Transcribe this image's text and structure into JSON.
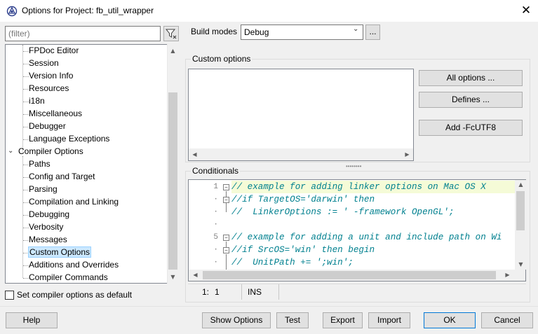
{
  "window": {
    "title": "Options for Project: fb_util_wrapper",
    "close_glyph": "✕",
    "icon": "lazarus-app-icon"
  },
  "filter": {
    "placeholder": "(filter)",
    "button_icon": "filter-funnel-icon"
  },
  "tree": {
    "items": [
      {
        "label": "FPDoc Editor",
        "level": 1
      },
      {
        "label": "Session",
        "level": 1
      },
      {
        "label": "Version Info",
        "level": 1
      },
      {
        "label": "Resources",
        "level": 1
      },
      {
        "label": "i18n",
        "level": 1
      },
      {
        "label": "Miscellaneous",
        "level": 1
      },
      {
        "label": "Debugger",
        "level": 1
      },
      {
        "label": "Language Exceptions",
        "level": 1
      },
      {
        "label": "Compiler Options",
        "level": 0,
        "expanded": true
      },
      {
        "label": "Paths",
        "level": 1
      },
      {
        "label": "Config and Target",
        "level": 1
      },
      {
        "label": "Parsing",
        "level": 1
      },
      {
        "label": "Compilation and Linking",
        "level": 1
      },
      {
        "label": "Debugging",
        "level": 1
      },
      {
        "label": "Verbosity",
        "level": 1
      },
      {
        "label": "Messages",
        "level": 1
      },
      {
        "label": "Custom Options",
        "level": 1,
        "selected": true
      },
      {
        "label": "Additions and Overrides",
        "level": 1
      },
      {
        "label": "Compiler Commands",
        "level": 1
      }
    ],
    "selection_color": "#cce8ff"
  },
  "default_checkbox": {
    "label": "Set compiler options as default",
    "checked": false
  },
  "build_modes": {
    "label": "Build modes",
    "selected": "Debug",
    "dots_label": "..."
  },
  "custom_options": {
    "group_title": "Custom options",
    "text": "",
    "buttons": {
      "all_options": "All options ...",
      "defines": "Defines ...",
      "add_fcutf8": "Add -FcUTF8"
    }
  },
  "conditionals": {
    "group_title": "Conditionals",
    "gutter": [
      "1",
      "·",
      "·",
      "·",
      "5",
      "·",
      "·"
    ],
    "lines": [
      "// example for adding linker options on Mac OS X",
      "//if TargetOS='darwin' then",
      "//  LinkerOptions := ' -framework OpenGL';",
      "",
      "// example for adding a unit and include path on Wi",
      "//if SrcOS='win' then begin",
      "//  UnitPath += ';win';"
    ],
    "comment_color": "#00808f",
    "current_line_color": "#f5fbd7"
  },
  "status": {
    "line": "1:",
    "col": "1",
    "mode": "INS"
  },
  "bottom_buttons": {
    "help": "Help",
    "show_options": "Show Options",
    "test": "Test",
    "export": "Export",
    "import": "Import",
    "ok": "OK",
    "cancel": "Cancel"
  },
  "accent_color": "#0078d7"
}
